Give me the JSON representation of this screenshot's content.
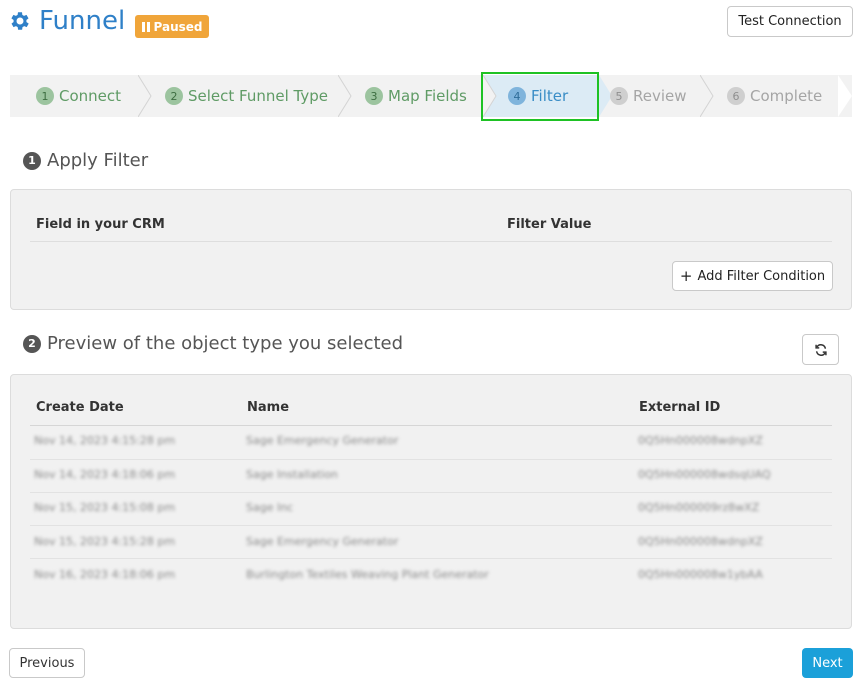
{
  "header": {
    "title": "Funnel",
    "status_badge": "Paused",
    "test_connection_label": "Test Connection",
    "icon": "gear-icon"
  },
  "stepper": {
    "steps": [
      {
        "num": "1",
        "label": "Connect",
        "state": "done"
      },
      {
        "num": "2",
        "label": "Select Funnel Type",
        "state": "done"
      },
      {
        "num": "3",
        "label": "Map Fields",
        "state": "done"
      },
      {
        "num": "4",
        "label": "Filter",
        "state": "active"
      },
      {
        "num": "5",
        "label": "Review",
        "state": "todo"
      },
      {
        "num": "6",
        "label": "Complete",
        "state": "todo"
      }
    ]
  },
  "apply_filter": {
    "number": "1",
    "title": "Apply Filter",
    "columns": [
      "Field in your CRM",
      "Filter Value"
    ],
    "add_condition_label": "Add Filter Condition"
  },
  "preview": {
    "number": "2",
    "title": "Preview of the object type you selected",
    "columns": [
      "Create Date",
      "Name",
      "External ID"
    ],
    "rows": [
      [
        "Nov 14, 2023 4:15:28 pm",
        "Sage Emergency Generator",
        "0Q5Hn000008wdnpXZ"
      ],
      [
        "Nov 14, 2023 4:18:06 pm",
        "Sage Installation",
        "0Q5Hn000008wdsqUAQ"
      ],
      [
        "Nov 15, 2023 4:15:08 pm",
        "Sage Inc",
        "0Q5Hn000009rz8wXZ"
      ],
      [
        "Nov 15, 2023 4:15:28 pm",
        "Sage Emergency Generator",
        "0Q5Hn000008wdnpXZ"
      ],
      [
        "Nov 16, 2023 4:18:06 pm",
        "Burlington Textiles Weaving Plant Generator",
        "0Q5Hn000008w1ybAA"
      ]
    ]
  },
  "nav": {
    "previous_label": "Previous",
    "next_label": "Next"
  },
  "colors": {
    "brand_blue": "#2f80c8",
    "paused_orange": "#f0a53a",
    "done_green": "#5f9b65",
    "active_blue": "#3a8dc6",
    "next_button": "#1ba0d9",
    "highlight_green": "#1ec224"
  }
}
